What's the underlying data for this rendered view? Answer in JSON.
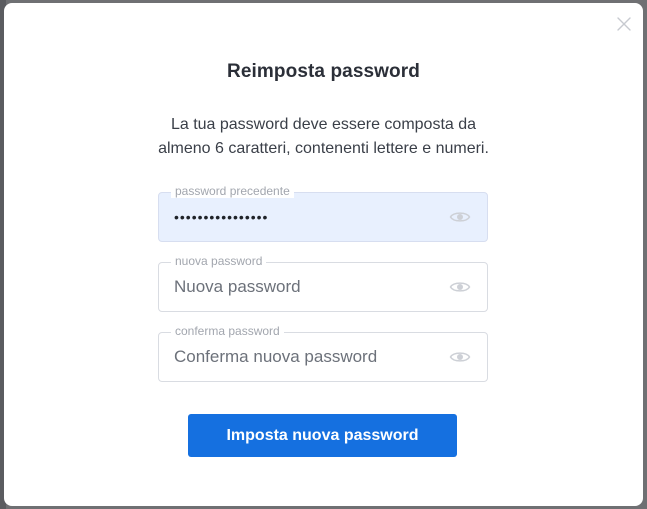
{
  "modal": {
    "title": "Reimposta password",
    "description_line1": "La tua password deve essere composta da",
    "description_line2": "almeno 6 caratteri, contenenti lettere e numeri."
  },
  "fields": {
    "old_password": {
      "label": "password precedente",
      "value": "••••••••••••••••",
      "placeholder": ""
    },
    "new_password": {
      "label": "nuova password",
      "value": "",
      "placeholder": "Nuova password"
    },
    "confirm_password": {
      "label": "conferma password",
      "value": "",
      "placeholder": "Conferma nuova password"
    }
  },
  "submit_label": "Imposta nuova password",
  "icons": {
    "close": "close-icon",
    "toggle_visibility": "eye-icon"
  },
  "colors": {
    "primary": "#1570e0",
    "autofill_bg": "#e8f0fe",
    "overlay": "#6f7073"
  }
}
